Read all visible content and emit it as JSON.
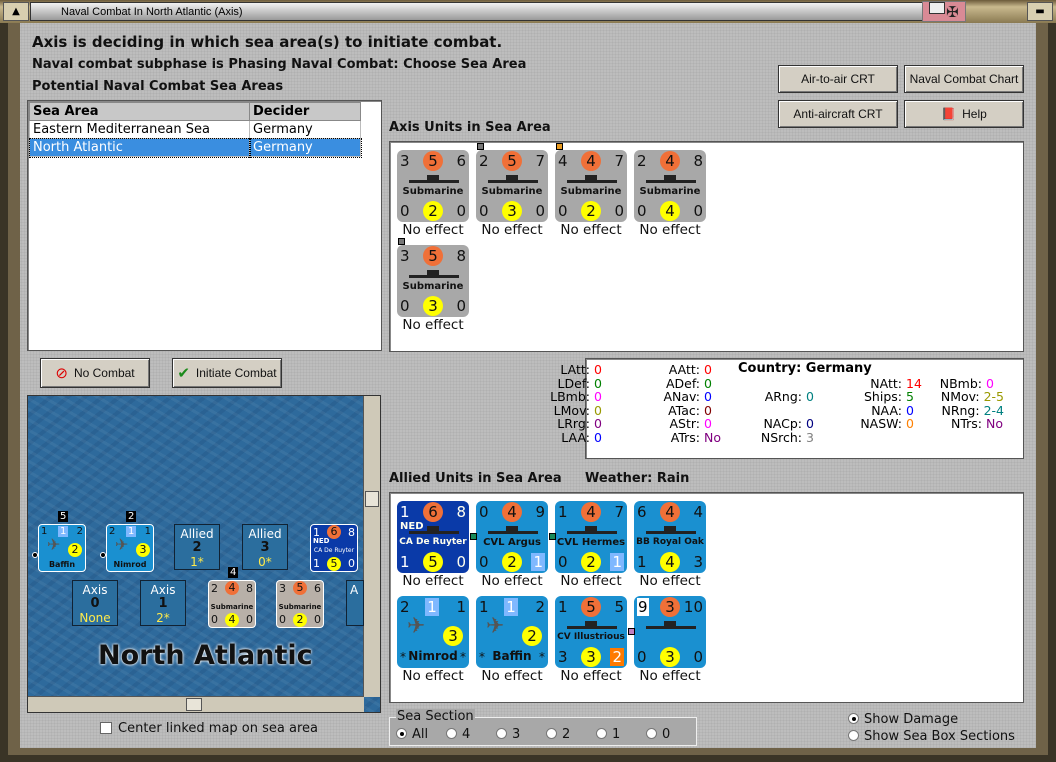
{
  "window": {
    "title": "Naval Combat In North Atlantic (Axis)"
  },
  "header": {
    "line1": "Axis is deciding in which sea area(s) to initiate combat.",
    "line2": "Naval combat subphase is Phasing Naval Combat: Choose Sea Area",
    "line3": "Potential Naval Combat Sea Areas"
  },
  "table": {
    "columns": [
      "Sea Area",
      "Decider"
    ],
    "rows": [
      [
        "Eastern Mediterranean Sea",
        "Germany"
      ],
      [
        "North Atlantic",
        "Germany"
      ]
    ],
    "selected": 1
  },
  "buttons": {
    "air_to_air": "Air-to-air CRT",
    "naval_chart": "Naval Combat Chart",
    "anti_aircraft": "Anti-aircraft CRT",
    "help": "Help",
    "no_combat": "No Combat",
    "initiate": "Initiate Combat"
  },
  "axis_units": {
    "label": "Axis Units in Sea Area",
    "units": [
      {
        "tl": "3",
        "tc": "5",
        "tr": "6",
        "name": "Submarine",
        "bl": "0",
        "bc": "2",
        "br": "0",
        "result": "No effect"
      },
      {
        "tl": "2",
        "tc": "5",
        "tr": "7",
        "name": "Submarine",
        "bl": "0",
        "bc": "3",
        "br": "0",
        "result": "No effect",
        "marker": "#777777"
      },
      {
        "tl": "4",
        "tc": "4",
        "tr": "7",
        "name": "Submarine",
        "bl": "0",
        "bc": "2",
        "br": "0",
        "result": "No effect",
        "marker": "#e89a20"
      },
      {
        "tl": "2",
        "tc": "4",
        "tr": "8",
        "name": "Submarine",
        "bl": "0",
        "bc": "4",
        "br": "0",
        "result": "No effect"
      },
      {
        "tl": "3",
        "tc": "5",
        "tr": "8",
        "name": "Submarine",
        "bl": "0",
        "bc": "3",
        "br": "0",
        "result": "No effect",
        "marker": "#777777"
      }
    ]
  },
  "stats": {
    "country_label": "Country: Germany",
    "items": [
      {
        "k": "LAtt:",
        "v": "0",
        "c": "#ff0000"
      },
      {
        "k": "LDef:",
        "v": "0",
        "c": "#008000"
      },
      {
        "k": "LBmb:",
        "v": "0",
        "c": "#ff00ff"
      },
      {
        "k": "LMov:",
        "v": "0",
        "c": "#999900"
      },
      {
        "k": "LRrg:",
        "v": "0",
        "c": "#800080"
      },
      {
        "k": "LAA:",
        "v": "0",
        "c": "#0000ff"
      },
      {
        "k": "AAtt:",
        "v": "0",
        "c": "#ff0000"
      },
      {
        "k": "ADef:",
        "v": "0",
        "c": "#008000"
      },
      {
        "k": "ANav:",
        "v": "0",
        "c": "#0000ff"
      },
      {
        "k": "ATac:",
        "v": "0",
        "c": "#800000"
      },
      {
        "k": "AStr:",
        "v": "0",
        "c": "#ff00ff"
      },
      {
        "k": "ATrs:",
        "v": "No",
        "c": "#800080"
      },
      {
        "k": "ARng:",
        "v": "0",
        "c": "#008080"
      },
      {
        "k": "NACp:",
        "v": "0",
        "c": "#000080"
      },
      {
        "k": "NSrch:",
        "v": "3",
        "c": "#808080"
      },
      {
        "k": "NAtt:",
        "v": "14",
        "c": "#ff0000"
      },
      {
        "k": "Ships:",
        "v": "5",
        "c": "#008000"
      },
      {
        "k": "NAA:",
        "v": "0",
        "c": "#0000ff"
      },
      {
        "k": "NASW:",
        "v": "0",
        "c": "#ff8000"
      },
      {
        "k": "NBmb:",
        "v": "0",
        "c": "#ff00ff"
      },
      {
        "k": "NMov:",
        "v": "2-5",
        "c": "#999900"
      },
      {
        "k": "NRng:",
        "v": "2-4",
        "c": "#008080"
      },
      {
        "k": "NTrs:",
        "v": "No",
        "c": "#800080"
      }
    ]
  },
  "allied_units": {
    "label": "Allied Units in Sea Area",
    "weather": "Weather:  Rain",
    "units": [
      {
        "tl": "1",
        "tc": "6",
        "tr": "8",
        "name": "CA De Ruyter",
        "nation": "NED",
        "bl": "1",
        "bc": "5",
        "br": "0",
        "result": "No effect",
        "dark": true
      },
      {
        "tl": "0",
        "tc": "4",
        "tr": "9",
        "name": "CVL Argus",
        "bl": "0",
        "bc": "2",
        "br": "1",
        "brbox": "#7fb8ff",
        "result": "No effect",
        "marker": "#1a8a5a"
      },
      {
        "tl": "1",
        "tc": "4",
        "tr": "7",
        "name": "CVL Hermes",
        "bl": "0",
        "bc": "2",
        "br": "1",
        "brbox": "#7fb8ff",
        "result": "No effect",
        "marker": "#1a8a5a"
      },
      {
        "tl": "6",
        "tc": "4",
        "tr": "4",
        "name": "BB Royal Oak",
        "bl": "1",
        "bc": "4",
        "br": "3",
        "result": "No effect"
      },
      {
        "tl": "2",
        "tc": "1",
        "tr": "1",
        "name": "Nimrod",
        "plane": true,
        "bl": "*",
        "bc": "3",
        "br": "*",
        "result": "No effect"
      },
      {
        "tl": "1",
        "tc": "1",
        "tr": "2",
        "name": "Baffin",
        "plane": true,
        "bl": "*",
        "bc": "2",
        "br": "*",
        "result": "No effect"
      },
      {
        "tl": "1",
        "tc": "5",
        "tr": "5",
        "name": "CV Illustrious",
        "bl": "3",
        "bc": "3",
        "br": "2",
        "brbox": "#ff7a00",
        "result": "No effect"
      },
      {
        "tl": "9",
        "tc": "3",
        "tr": "10",
        "name": "",
        "bl": "0",
        "bc": "3",
        "br": "0",
        "result": "No effect",
        "marker": "#c080c0",
        "tlwhite": true
      }
    ]
  },
  "map": {
    "sea_area": "North Atlantic",
    "stacks": [
      {
        "count": "5",
        "name": "Baffin",
        "tl": "1",
        "tc": "1",
        "tr": "2",
        "bc": "2"
      },
      {
        "count": "2",
        "name": "Nimrod",
        "tl": "2",
        "tc": "1",
        "tr": "1",
        "bc": "3"
      }
    ],
    "boxes": [
      {
        "side": "Allied",
        "n": "2",
        "v": "1*"
      },
      {
        "side": "Allied",
        "n": "3",
        "v": "0*"
      },
      {
        "side": "Axis",
        "n": "0",
        "v": "None"
      },
      {
        "side": "Axis",
        "n": "1",
        "v": "2*"
      }
    ],
    "ship": {
      "nation": "NED",
      "name": "CA De Ruyter",
      "tl": "1",
      "tc": "6",
      "tr": "8",
      "bl": "1",
      "bc": "5",
      "br": "0"
    },
    "subs": [
      {
        "count": "4",
        "tl": "2",
        "tc": "4",
        "tr": "8",
        "bl": "0",
        "bc": "4",
        "br": "0",
        "name": "Submarine"
      },
      {
        "tl": "3",
        "tc": "5",
        "tr": "6",
        "bl": "0",
        "bc": "2",
        "br": "0",
        "name": "Submarine"
      }
    ],
    "partial_box": "A"
  },
  "center_map": {
    "label": "Center linked map on sea area",
    "checked": false
  },
  "sea_section": {
    "label": "Sea Section",
    "options": [
      "All",
      "4",
      "3",
      "2",
      "1",
      "0"
    ],
    "selected": "All"
  },
  "view": {
    "options": [
      "Show Damage",
      "Show Sea Box Sections"
    ],
    "selected": "Show Damage"
  },
  "colors": {
    "attack_circle": "#f07038",
    "defense_circle": "#ffff00",
    "allied_counter": "#1a90d0",
    "dutch_counter": "#0a3aa8",
    "axis_counter": "#a8a8a8",
    "selected_row": "#3a8ee0"
  }
}
